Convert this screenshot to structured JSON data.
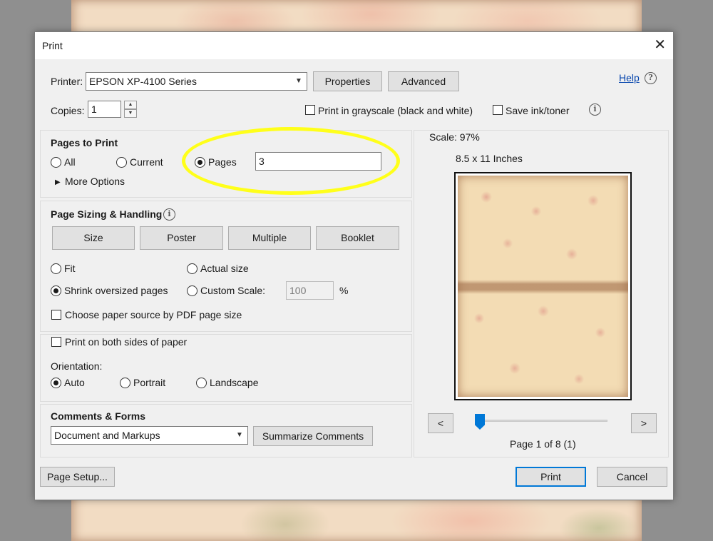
{
  "dialog": {
    "title": "Print"
  },
  "printer": {
    "label": "Printer:",
    "selected": "EPSON XP-4100 Series",
    "properties_label": "Properties",
    "advanced_label": "Advanced",
    "help_label": "Help"
  },
  "copies": {
    "label": "Copies:",
    "value": "1"
  },
  "options": {
    "grayscale_label": "Print in grayscale (black and white)",
    "save_ink_label": "Save ink/toner"
  },
  "pages_to_print": {
    "title": "Pages to Print",
    "all_label": "All",
    "current_label": "Current",
    "pages_label": "Pages",
    "pages_value": "3",
    "more_options_label": "More Options",
    "selected": "Pages"
  },
  "sizing": {
    "title": "Page Sizing & Handling",
    "tabs": [
      "Size",
      "Poster",
      "Multiple",
      "Booklet"
    ],
    "fit_label": "Fit",
    "actual_size_label": "Actual size",
    "shrink_label": "Shrink oversized pages",
    "custom_scale_label": "Custom Scale:",
    "custom_scale_value": "100",
    "percent_sign": "%",
    "paper_source_label": "Choose paper source by PDF page size",
    "selected": "Shrink oversized pages"
  },
  "duplex": {
    "both_sides_label": "Print on both sides of paper",
    "orientation_label": "Orientation:",
    "auto_label": "Auto",
    "portrait_label": "Portrait",
    "landscape_label": "Landscape",
    "selected": "Auto"
  },
  "comments": {
    "title": "Comments & Forms",
    "selected": "Document and Markups",
    "summarize_label": "Summarize Comments"
  },
  "preview": {
    "scale_text": "Scale:  97%",
    "size_text": "8.5 x 11 Inches",
    "prev_label": "<",
    "next_label": ">",
    "page_text": "Page 1 of 8 (1)",
    "current_page": 1,
    "total_pages": 8
  },
  "footer": {
    "page_setup_label": "Page Setup...",
    "print_label": "Print",
    "cancel_label": "Cancel"
  },
  "colors": {
    "accent": "#0078d7",
    "highlight": "#ffff1a",
    "dialog_bg": "#f0f0f0"
  }
}
